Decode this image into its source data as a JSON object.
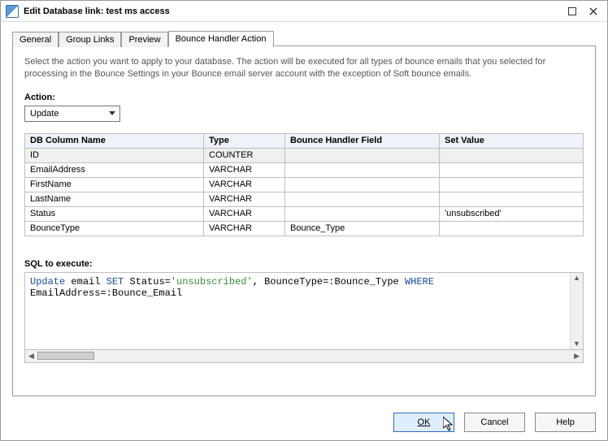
{
  "window": {
    "title": "Edit Database link: test ms access"
  },
  "tabs": {
    "general": "General",
    "group_links": "Group Links",
    "preview": "Preview",
    "bounce_handler": "Bounce Handler Action"
  },
  "description": "Select the action you want to apply to your database. The action will be executed for all types of bounce emails that you selected for processing in the Bounce Settings in your Bounce email server account with the exception of Soft bounce emails.",
  "action": {
    "label": "Action:",
    "value": "Update"
  },
  "table": {
    "headers": {
      "col": "DB Column Name",
      "type": "Type",
      "field": "Bounce Handler Field",
      "set": "Set Value"
    },
    "rows": [
      {
        "col": "ID",
        "type": "COUNTER",
        "field": "",
        "set": ""
      },
      {
        "col": "EmailAddress",
        "type": "VARCHAR",
        "field": "",
        "set": ""
      },
      {
        "col": "FirstName",
        "type": "VARCHAR",
        "field": "",
        "set": ""
      },
      {
        "col": "LastName",
        "type": "VARCHAR",
        "field": "",
        "set": ""
      },
      {
        "col": "Status",
        "type": "VARCHAR",
        "field": "",
        "set": "'unsubscribed'"
      },
      {
        "col": "BounceType",
        "type": "VARCHAR",
        "field": "Bounce_Type",
        "set": ""
      }
    ]
  },
  "sql": {
    "label": "SQL to execute:",
    "tokens": [
      {
        "t": "kw",
        "v": "Update"
      },
      {
        "t": "",
        "v": " email "
      },
      {
        "t": "kw",
        "v": "SET"
      },
      {
        "t": "",
        "v": " Status="
      },
      {
        "t": "str",
        "v": "'unsubscribed'"
      },
      {
        "t": "",
        "v": ", BounceType=:Bounce_Type "
      },
      {
        "t": "kw",
        "v": "WHERE"
      },
      {
        "t": "",
        "v": "\nEmailAddress=:Bounce_Email"
      }
    ]
  },
  "buttons": {
    "ok": "OK",
    "cancel": "Cancel",
    "help": "Help"
  }
}
